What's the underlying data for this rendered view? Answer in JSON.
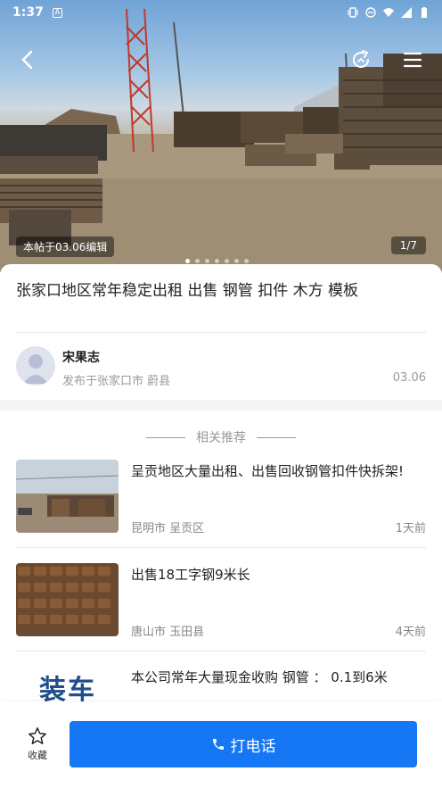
{
  "statusbar": {
    "time": "1:37",
    "a_badge": "A"
  },
  "hero": {
    "edit_tag": "本帖于03.06编辑",
    "counter": "1/7",
    "dots": 7,
    "active_dot": 0
  },
  "detail": {
    "title": "张家口地区常年稳定出租 出售 钢管 扣件 木方 模板",
    "author": "宋果志",
    "publish_info": "发布于张家口市 蔚县",
    "date": "03.06"
  },
  "recommend": {
    "heading": "相关推荐",
    "items": [
      {
        "title": "呈贡地区大量出租、出售回收钢管扣件快拆架!",
        "location": "昆明市 呈贡区",
        "time_ago": "1天前"
      },
      {
        "title": "出售18工字钢9米长",
        "location": "唐山市 玉田县",
        "time_ago": "4天前"
      },
      {
        "title": "本公司常年大量现金收购 钢管 ： 0.1到6米",
        "thumb_text": "装车"
      }
    ]
  },
  "bottombar": {
    "favorite_label": "收藏",
    "call_label": "打电话"
  },
  "colors": {
    "accent": "#1677f5"
  },
  "icons": [
    "back-arrow-icon",
    "share-icon",
    "menu-icon",
    "star-icon",
    "phone-icon"
  ]
}
